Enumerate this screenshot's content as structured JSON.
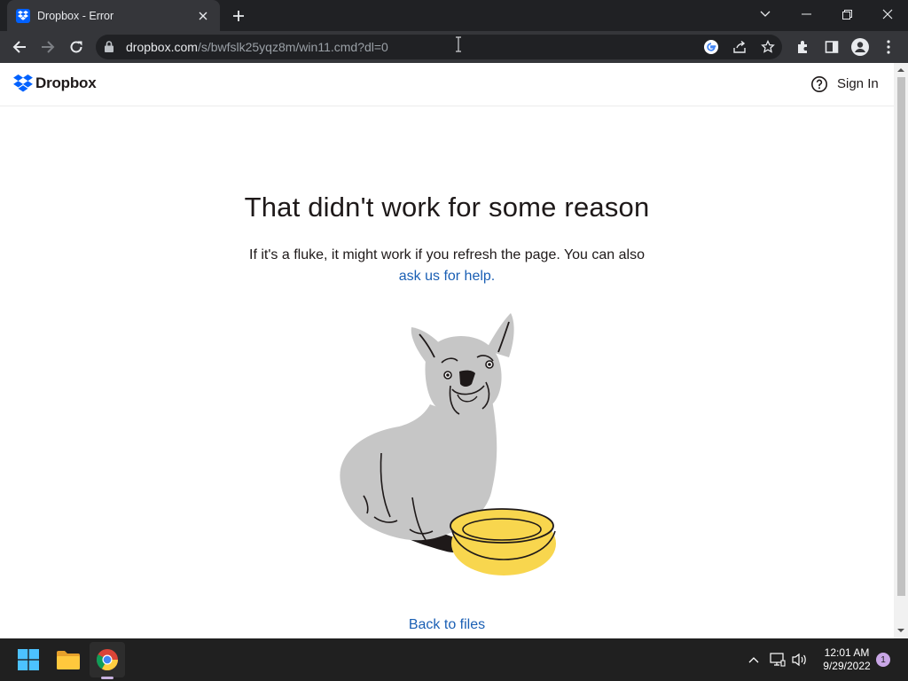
{
  "browser": {
    "tab_title": "Dropbox - Error",
    "url_host": "dropbox.com",
    "url_path": "/s/bwfslk25yqz8m/win11.cmd?dl=0"
  },
  "site": {
    "logo_text": "Dropbox",
    "sign_in": "Sign In"
  },
  "error": {
    "heading": "That didn't work for some reason",
    "message": "If it's a fluke, it might work if you refresh the page. You can also",
    "help_link": "ask us for help.",
    "back_link": "Back to files"
  },
  "taskbar": {
    "time": "12:01 AM",
    "date": "9/29/2022",
    "notification_count": "1"
  },
  "colors": {
    "brand": "#0061fe",
    "link": "#1a5fb4",
    "bowl": "#f8d64e",
    "dog": "#c6c6c6"
  }
}
